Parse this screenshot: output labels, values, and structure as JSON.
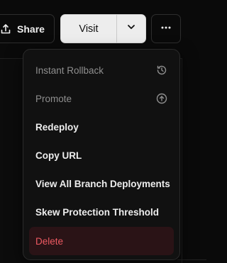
{
  "toolbar": {
    "share_label": "Share",
    "share_icon": "share-icon",
    "visit_label": "Visit",
    "visit_caret_icon": "chevron-down-icon",
    "more_icon": "more-horizontal-icon"
  },
  "menu": {
    "items": [
      {
        "label": "Instant Rollback",
        "icon": "history-icon",
        "disabled": true
      },
      {
        "label": "Promote",
        "icon": "arrow-up-circle-icon",
        "disabled": true
      },
      {
        "label": "Redeploy",
        "disabled": false
      },
      {
        "label": "Copy URL",
        "disabled": false
      },
      {
        "label": "View All Branch Deployments",
        "disabled": false
      },
      {
        "label": "Skew Protection Threshold",
        "disabled": false
      },
      {
        "label": "Delete",
        "disabled": false,
        "variant": "danger"
      }
    ]
  },
  "colors": {
    "background": "#0a0a0a",
    "menu_background": "#111111",
    "danger_text": "#ee5a62",
    "danger_background": "#2a1316",
    "disabled_text": "#8f8f8f",
    "visit_button_background": "#ededed"
  }
}
